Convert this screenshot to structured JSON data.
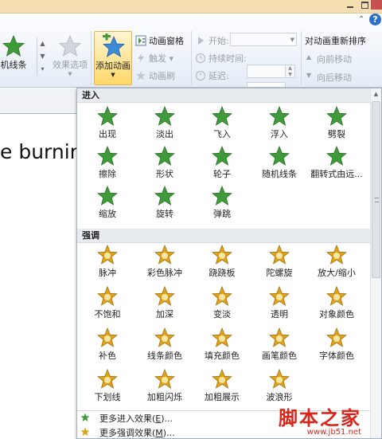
{
  "window": {
    "collapse_glyph": "⌃",
    "help_glyph": "?"
  },
  "ribbon": {
    "gallery_label": "机线条",
    "effect_options_label": "效果选项",
    "add_animation_label": "添加动画",
    "add_animation_arrow": "▼",
    "animation_pane_label": "动画窗格",
    "trigger_label": "触发 ▾",
    "animation_painter_label": "动画刷",
    "start_label": "开始:",
    "duration_label": "持续时间:",
    "delay_label": "延迟:",
    "reorder_title": "对动画重新排序",
    "move_earlier_label": "向前移动",
    "move_later_label": "向后移动"
  },
  "slide": {
    "visible_text": "e burnin"
  },
  "dropdown": {
    "sections": [
      {
        "title": "进入",
        "items": [
          "出现",
          "淡出",
          "飞入",
          "浮入",
          "劈裂",
          "擦除",
          "形状",
          "轮子",
          "随机线条",
          "翻转式由远...",
          "缩放",
          "旋转",
          "弹跳"
        ]
      },
      {
        "title": "强调",
        "items": [
          "脉冲",
          "彩色脉冲",
          "跷跷板",
          "陀螺旋",
          "放大/缩小",
          "不饱和",
          "加深",
          "变淡",
          "透明",
          "对象颜色",
          "补色",
          "线条颜色",
          "填充颜色",
          "画笔颜色",
          "字体颜色",
          "下划线",
          "加粗闪烁",
          "加粗展示",
          "波浪形"
        ]
      }
    ],
    "more": [
      {
        "prefix": "更多进入效果(",
        "hotkey": "E",
        "suffix": ")..."
      },
      {
        "prefix": "更多强调效果(",
        "hotkey": "M",
        "suffix": ")..."
      }
    ]
  },
  "watermark": {
    "main": "脚本之家",
    "url": "www.jb51.net"
  },
  "colors": {
    "entrance_star": "#3f9a3a",
    "emphasis_star": "#e0a21a",
    "highlight": "#ffd76a",
    "accent_red": "#d9261c"
  }
}
